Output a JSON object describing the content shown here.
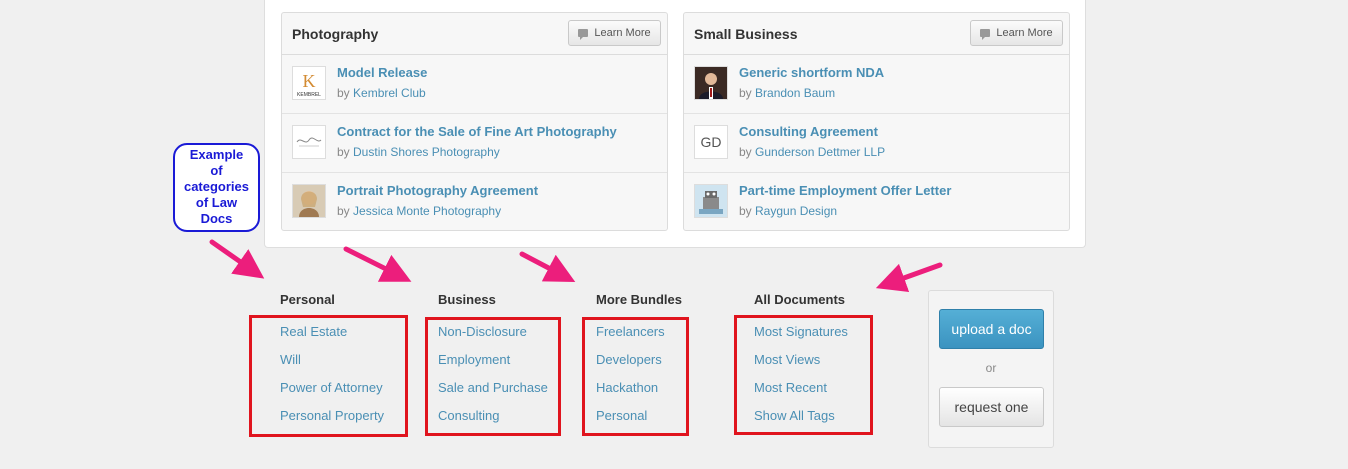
{
  "cards": [
    {
      "title": "Photography",
      "learn_more": "Learn More",
      "docs": [
        {
          "title": "Model Release",
          "by": "by ",
          "author": "Kembrel Club",
          "thumb": "kembrel-logo-icon"
        },
        {
          "title": "Contract for the Sale of Fine Art Photography",
          "by": "by ",
          "author": "Dustin Shores Photography",
          "thumb": "signature-logo-icon"
        },
        {
          "title": "Portrait Photography Agreement",
          "by": "by ",
          "author": "Jessica Monte Photography",
          "thumb": "portrait-photo-icon"
        }
      ]
    },
    {
      "title": "Small Business",
      "learn_more": "Learn More",
      "docs": [
        {
          "title": "Generic shortform NDA",
          "by": "by ",
          "author": "Brandon Baum",
          "thumb": "suit-portrait-icon"
        },
        {
          "title": "Consulting Agreement",
          "by": "by ",
          "author": "Gunderson Dettmer LLP",
          "thumb": "gd-logo-icon"
        },
        {
          "title": "Part-time Employment Offer Letter",
          "by": "by ",
          "author": "Raygun Design",
          "thumb": "robot-illustration-icon"
        }
      ]
    }
  ],
  "categories": [
    {
      "heading": "Personal",
      "links": [
        "Real Estate",
        "Will",
        "Power of Attorney",
        "Personal Property"
      ]
    },
    {
      "heading": "Business",
      "links": [
        "Non-Disclosure",
        "Employment",
        "Sale and Purchase",
        "Consulting"
      ]
    },
    {
      "heading": "More Bundles",
      "links": [
        "Freelancers",
        "Developers",
        "Hackathon",
        "Personal"
      ]
    },
    {
      "heading": "All Documents",
      "links": [
        "Most Signatures",
        "Most Views",
        "Most Recent",
        "Show All Tags"
      ]
    }
  ],
  "upload": {
    "upload_label": "upload a doc",
    "or_label": "or",
    "request_label": "request one"
  },
  "annotation": {
    "lines": [
      "Example",
      "of",
      "categories",
      "of Law",
      "Docs"
    ]
  },
  "colors": {
    "link": "#4a8fb4",
    "highlight_box": "#e0141e",
    "arrow": "#ec1e7c",
    "annotation": "#1a1ad6",
    "upload_button": "#3b93c0"
  }
}
